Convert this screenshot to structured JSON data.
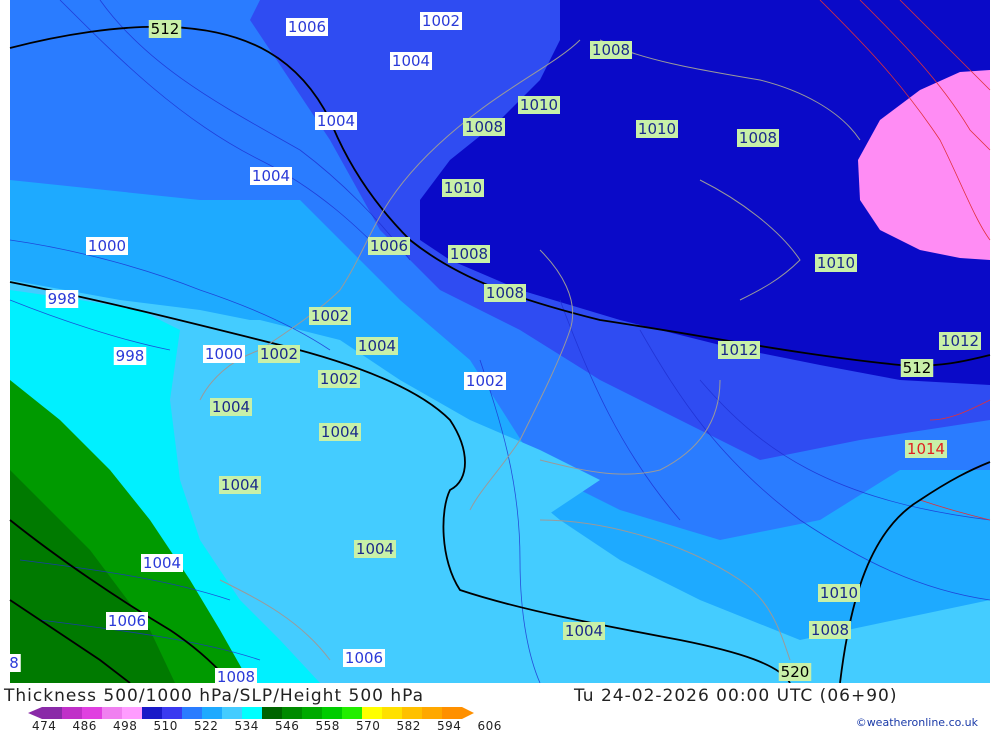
{
  "title": {
    "left": "Thickness 500/1000 hPa/SLP/Height 500 hPa",
    "right": "Tu 24-02-2026 00:00 UTC (06+90)"
  },
  "credit": "©weatheronline.co.uk",
  "legend": {
    "colors": [
      "#8a2aa8",
      "#c030c8",
      "#e040e0",
      "#f080f0",
      "#ff9cff",
      "#1a1ac8",
      "#3a3af0",
      "#2a7cff",
      "#1eaaff",
      "#44ccff",
      "#00ffff",
      "#006400",
      "#008a00",
      "#00aa00",
      "#00cc00",
      "#22ee00",
      "#ffff00",
      "#ffe000",
      "#ffc000",
      "#ffa800",
      "#ff9000"
    ],
    "labels": [
      "474",
      "486",
      "498",
      "510",
      "522",
      "534",
      "546",
      "558",
      "570",
      "582",
      "594",
      "606"
    ]
  },
  "map": {
    "colors": {
      "deep_blue": "#0a0ac8",
      "mid_blue": "#2f4cf2",
      "blue": "#2a7cff",
      "light_blue": "#1eaaff",
      "sky": "#44ccff",
      "cyan": "#00f0ff",
      "green_dark": "#007a00",
      "green": "#009a00",
      "pink": "#ff8cf4"
    },
    "labels": [
      {
        "text": "512",
        "kind": "height"
      },
      {
        "text": "1006",
        "kind": "blue"
      },
      {
        "text": "1002",
        "kind": "blue"
      },
      {
        "text": "1004",
        "kind": "blue"
      },
      {
        "text": "1008",
        "kind": "green"
      },
      {
        "text": "1010",
        "kind": "green"
      },
      {
        "text": "1004",
        "kind": "blue"
      },
      {
        "text": "1008",
        "kind": "green"
      },
      {
        "text": "1010",
        "kind": "green"
      },
      {
        "text": "1008",
        "kind": "green"
      },
      {
        "text": "1004",
        "kind": "blue"
      },
      {
        "text": "1010",
        "kind": "green"
      },
      {
        "text": "1000",
        "kind": "blue"
      },
      {
        "text": "1006",
        "kind": "green"
      },
      {
        "text": "1008",
        "kind": "green"
      },
      {
        "text": "1010",
        "kind": "green"
      },
      {
        "text": "998",
        "kind": "blue"
      },
      {
        "text": "1008",
        "kind": "green"
      },
      {
        "text": "1002",
        "kind": "green"
      },
      {
        "text": "1004",
        "kind": "green"
      },
      {
        "text": "998",
        "kind": "blue"
      },
      {
        "text": "1000",
        "kind": "blue"
      },
      {
        "text": "1002",
        "kind": "green"
      },
      {
        "text": "1012",
        "kind": "green"
      },
      {
        "text": "1012",
        "kind": "green"
      },
      {
        "text": "512",
        "kind": "height"
      },
      {
        "text": "1002",
        "kind": "green"
      },
      {
        "text": "1002",
        "kind": "blue"
      },
      {
        "text": "1004",
        "kind": "green"
      },
      {
        "text": "1004",
        "kind": "green"
      },
      {
        "text": "1014",
        "kind": "red"
      },
      {
        "text": "1004",
        "kind": "green"
      },
      {
        "text": "1004",
        "kind": "green"
      },
      {
        "text": "1004",
        "kind": "blue"
      },
      {
        "text": "1010",
        "kind": "green"
      },
      {
        "text": "1006",
        "kind": "blue"
      },
      {
        "text": "1004",
        "kind": "green"
      },
      {
        "text": "1008",
        "kind": "green"
      },
      {
        "text": "8",
        "kind": "blue"
      },
      {
        "text": "1006",
        "kind": "blue"
      },
      {
        "text": "1008",
        "kind": "blue"
      },
      {
        "text": "520",
        "kind": "height"
      }
    ]
  }
}
